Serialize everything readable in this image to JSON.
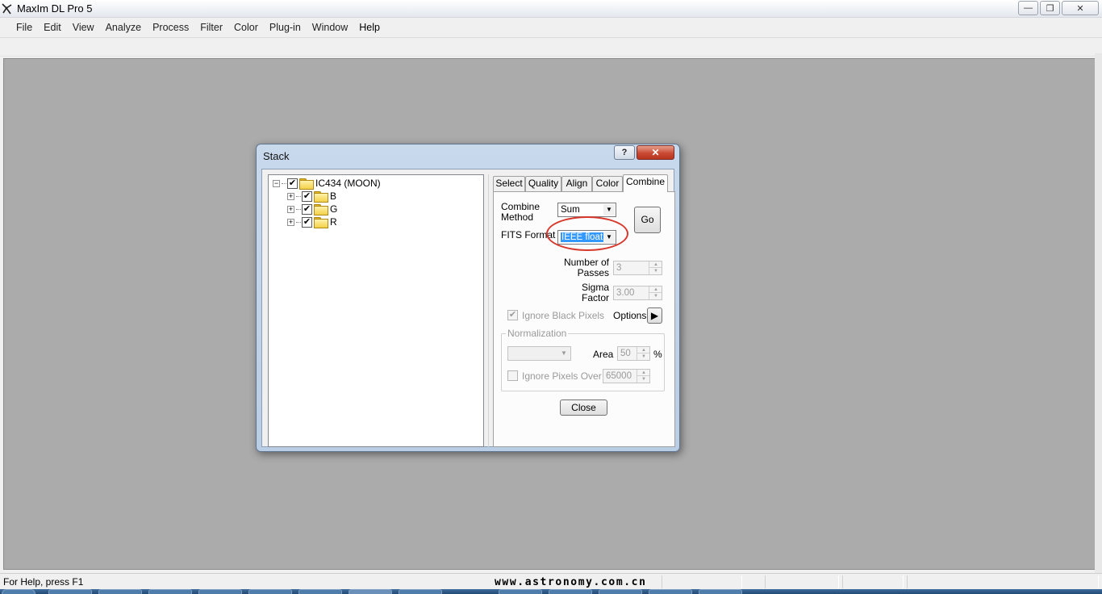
{
  "app": {
    "title": "MaxIm DL Pro 5",
    "icon": "maxim-app-icon"
  },
  "window_controls": {
    "minimize": "—",
    "restore": "❐",
    "close": "✕"
  },
  "menu": [
    "File",
    "Edit",
    "View",
    "Analyze",
    "Process",
    "Filter",
    "Color",
    "Plug-in",
    "Window",
    "Help"
  ],
  "status": {
    "text": "For Help, press F1",
    "watermark": "www.astronomy.com.cn"
  },
  "dialog": {
    "title": "Stack",
    "help_glyph": "?",
    "close_glyph": "✕",
    "tree": {
      "root": {
        "label": "IC434 (MOON)",
        "checked": true,
        "expanded": true
      },
      "children": [
        {
          "label": "B",
          "checked": true,
          "expanded": false
        },
        {
          "label": "G",
          "checked": true,
          "expanded": false
        },
        {
          "label": "R",
          "checked": true,
          "expanded": false
        }
      ]
    },
    "tabs": [
      "Select",
      "Quality",
      "Align",
      "Color",
      "Combine"
    ],
    "active_tab": "Combine",
    "combine": {
      "method_label_1": "Combine",
      "method_label_2": "Method",
      "method_value": "Sum",
      "fits_label": "FITS Format",
      "fits_value": "IEEE float",
      "go_label": "Go",
      "passes_label_1": "Number of",
      "passes_label_2": "Passes",
      "passes_value": "3",
      "sigma_label_1": "Sigma",
      "sigma_label_2": "Factor",
      "sigma_value": "3.00",
      "ignore_black_label": "Ignore Black Pixels",
      "ignore_black_checked": true,
      "options_label": "Options",
      "options_arrow": "▶",
      "normalization_title": "Normalization",
      "normalization_value": "",
      "area_label": "Area",
      "area_value": "50",
      "area_unit": "%",
      "ignore_over_label": "Ignore Pixels Over",
      "ignore_over_checked": false,
      "ignore_over_value": "65000",
      "close_label": "Close"
    },
    "highlight_color": "#d8372c"
  }
}
